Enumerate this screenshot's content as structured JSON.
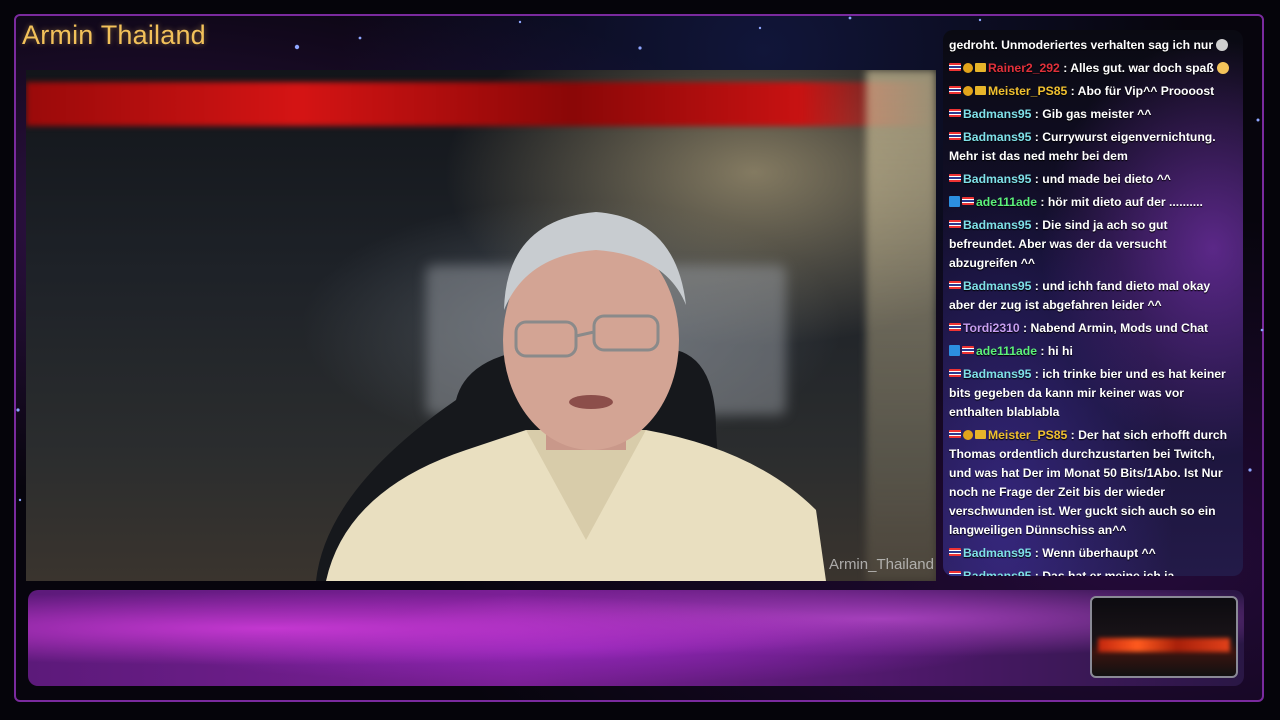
{
  "channel_title": "Armin Thailand",
  "webcam": {
    "watermark": "Armin_Thailand"
  },
  "colors": {
    "title": "#f2c15a",
    "frame": "#7a2a9e"
  },
  "chat": {
    "messages": [
      {
        "user": "",
        "user_color": "#ffffff",
        "badges": [],
        "text": "gedroht. Unmoderiertes verhalten sag ich nur",
        "emote": "grey"
      },
      {
        "user": "Rainer2_292",
        "user_color": "#e0303a",
        "badges": [
          "flag",
          "gold",
          "vip"
        ],
        "text": " : Alles gut. war doch spaß",
        "emote": "gold"
      },
      {
        "user": "Meister_PS85",
        "user_color": "#f0c030",
        "badges": [
          "flag",
          "gold",
          "vip"
        ],
        "text": " : Abo für Vip^^ Proooost",
        "emote": ""
      },
      {
        "user": "Badmans95",
        "user_color": "#7fe0e8",
        "badges": [
          "flag"
        ],
        "text": " : Gib gas meister ^^",
        "emote": ""
      },
      {
        "user": "Badmans95",
        "user_color": "#7fe0e8",
        "badges": [
          "flag"
        ],
        "text": " : Currywurst eigenvernichtung. Mehr ist das ned mehr bei dem",
        "emote": ""
      },
      {
        "user": "Badmans95",
        "user_color": "#7fe0e8",
        "badges": [
          "flag"
        ],
        "text": " : und made bei dieto ^^",
        "emote": ""
      },
      {
        "user": "ade111ade",
        "user_color": "#5cf07a",
        "badges": [
          "blue",
          "flag"
        ],
        "text": " : hör mit dieto auf der ..........",
        "emote": ""
      },
      {
        "user": "Badmans95",
        "user_color": "#7fe0e8",
        "badges": [
          "flag"
        ],
        "text": " : Die sind ja ach so gut befreundet. Aber was der da versucht abzugreifen ^^",
        "emote": ""
      },
      {
        "user": "Badmans95",
        "user_color": "#7fe0e8",
        "badges": [
          "flag"
        ],
        "text": " : und ichh fand dieto mal okay aber der zug ist abgefahren leider ^^",
        "emote": ""
      },
      {
        "user": "Tordi2310",
        "user_color": "#c79ef0",
        "badges": [
          "flag"
        ],
        "text": " : Nabend Armin, Mods und Chat",
        "emote": ""
      },
      {
        "user": "ade111ade",
        "user_color": "#5cf07a",
        "badges": [
          "blue",
          "flag"
        ],
        "text": " : hi hi",
        "emote": ""
      },
      {
        "user": "Badmans95",
        "user_color": "#7fe0e8",
        "badges": [
          "flag"
        ],
        "text": " : ich trinke bier und es hat keiner bits gegeben da kann mir keiner was vor enthalten blablabla",
        "emote": ""
      },
      {
        "user": "Meister_PS85",
        "user_color": "#f0c030",
        "badges": [
          "flag",
          "gold",
          "vip"
        ],
        "text": " : Der hat sich erhofft durch Thomas ordentlich durchzustarten bei Twitch, und was hat Der im Monat 50 Bits/1Abo. Ist Nur noch ne Frage der Zeit bis der wieder verschwunden ist. Wer guckt sich auch so ein langweiligen Dünnschiss an^^",
        "emote": ""
      },
      {
        "user": "Badmans95",
        "user_color": "#7fe0e8",
        "badges": [
          "flag"
        ],
        "text": " : Wenn überhaupt ^^",
        "emote": ""
      },
      {
        "user": "Badmans95",
        "user_color": "#7fe0e8",
        "badges": [
          "flag"
        ],
        "text": " : Das hat er meine ich ja",
        "emote": ""
      }
    ]
  }
}
